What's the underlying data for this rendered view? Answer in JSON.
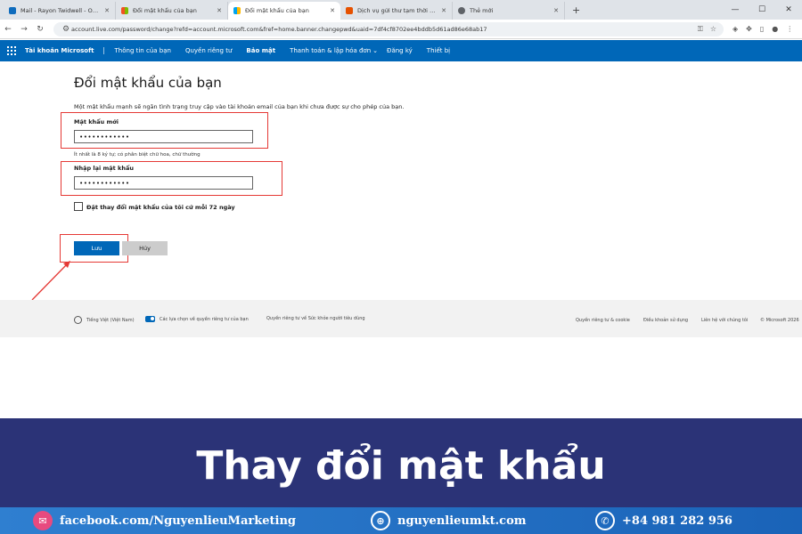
{
  "browser": {
    "tabs": [
      {
        "title": "Mail - Rayon Twidwell - Outlook",
        "favicon_color": "#0f6cbd"
      },
      {
        "title": "Đổi mật khẩu của bạn",
        "favicon_color": "#f25022"
      },
      {
        "title": "Đổi mật khẩu của bạn",
        "favicon_color": "#f25022"
      },
      {
        "title": "Dịch vụ gửi thư tạm thời miễn phí",
        "favicon_color": "#e65100"
      },
      {
        "title": "Thẻ mới",
        "favicon_color": "#5f6368"
      }
    ],
    "active_tab": 2,
    "url": "account.live.com/password/change?refd=account.microsoft.com&fref=home.banner.changepwd&uaid=7df4cf8702ee4bddb5d61ad86e68ab17"
  },
  "msnav": {
    "brand": "Tài khoản Microsoft",
    "items": [
      "Thông tin của bạn",
      "Quyền riêng tư",
      "Bảo mật",
      "Thanh toán & lập hóa đơn",
      "Đăng ký",
      "Thiết bị"
    ],
    "active_item": "Bảo mật",
    "brand_color": "#0067b8"
  },
  "form": {
    "heading": "Đổi mật khẩu của bạn",
    "intro": "Một mật khẩu mạnh sẽ ngăn tình trạng truy cập vào tài khoản email của bạn khi chưa được sự cho phép của bạn.",
    "new_password_label": "Mật khẩu mới",
    "new_password_value": "••••••••••••",
    "hint": "Ít nhất là 8 ký tự; có phân biệt chữ hoa, chữ thường",
    "confirm_label": "Nhập lại mật khẩu",
    "confirm_value": "••••••••••••",
    "checkbox_label": "Đặt thay đổi mật khẩu của tôi cứ mỗi 72 ngày",
    "save_label": "Lưu",
    "cancel_label": "Hủy",
    "highlight_color": "#e53935"
  },
  "footer": {
    "language": "Tiếng Việt (Việt Nam)",
    "privacy_choices": "Các lựa chọn về quyền riêng tư của bạn",
    "health_privacy": "Quyền riêng tư về Sức khỏe người tiêu dùng",
    "privacy_cookies": "Quyền riêng tư & cookie",
    "terms": "Điều khoản sử dụng",
    "contact": "Liên hệ với chúng tôi",
    "copyright": "© Microsoft 2026"
  },
  "banner": {
    "title": "Thay đổi mật khẩu",
    "facebook": "facebook.com/NguyenlieuMarketing",
    "website": "nguyenlieumkt.com",
    "phone": "+84 981 282 956"
  }
}
